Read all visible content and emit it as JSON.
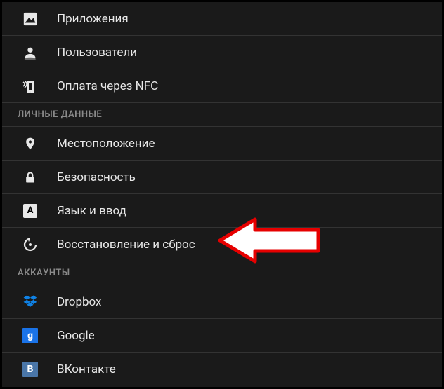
{
  "rows": {
    "apps": "Приложения",
    "users": "Пользователи",
    "nfc": "Оплата через NFC",
    "location": "Местоположение",
    "security": "Безопасность",
    "language": "Язык и ввод",
    "backup": "Восстановление и сброс",
    "dropbox": "Dropbox",
    "google": "Google",
    "vk": "ВКонтакте"
  },
  "sections": {
    "personal": "ЛИЧНЫЕ ДАННЫЕ",
    "accounts": "АККАУНТЫ"
  },
  "badges": {
    "google": "g",
    "vk": "В",
    "lang": "A"
  }
}
